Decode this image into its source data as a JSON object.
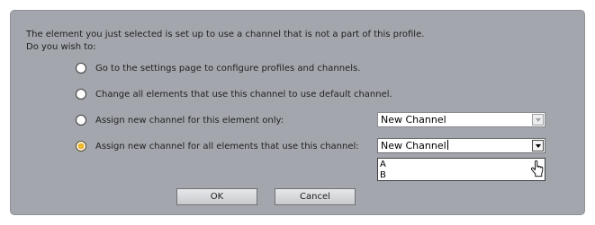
{
  "message": {
    "line1": "The element you just selected is set up to use a channel that is not a part of this profile.",
    "line2": "Do you wish to:"
  },
  "options": [
    {
      "label": "Go to the settings page to configure profiles and channels.",
      "selected": false
    },
    {
      "label": "Change all elements that use this channel to use default channel.",
      "selected": false
    },
    {
      "label": "Assign new channel for this element only:",
      "selected": false
    },
    {
      "label": "Assign new channel for all elements that use this channel:",
      "selected": true
    }
  ],
  "channel_select_element": {
    "value": "New Channel",
    "enabled": false
  },
  "channel_select_all": {
    "value": "New Channel",
    "enabled": true,
    "open": true,
    "options": [
      "A",
      "B"
    ]
  },
  "buttons": {
    "ok": "OK",
    "cancel": "Cancel"
  },
  "colors": {
    "dialog_background": "#a3a6ac",
    "radio_selected": "#e7a813"
  }
}
